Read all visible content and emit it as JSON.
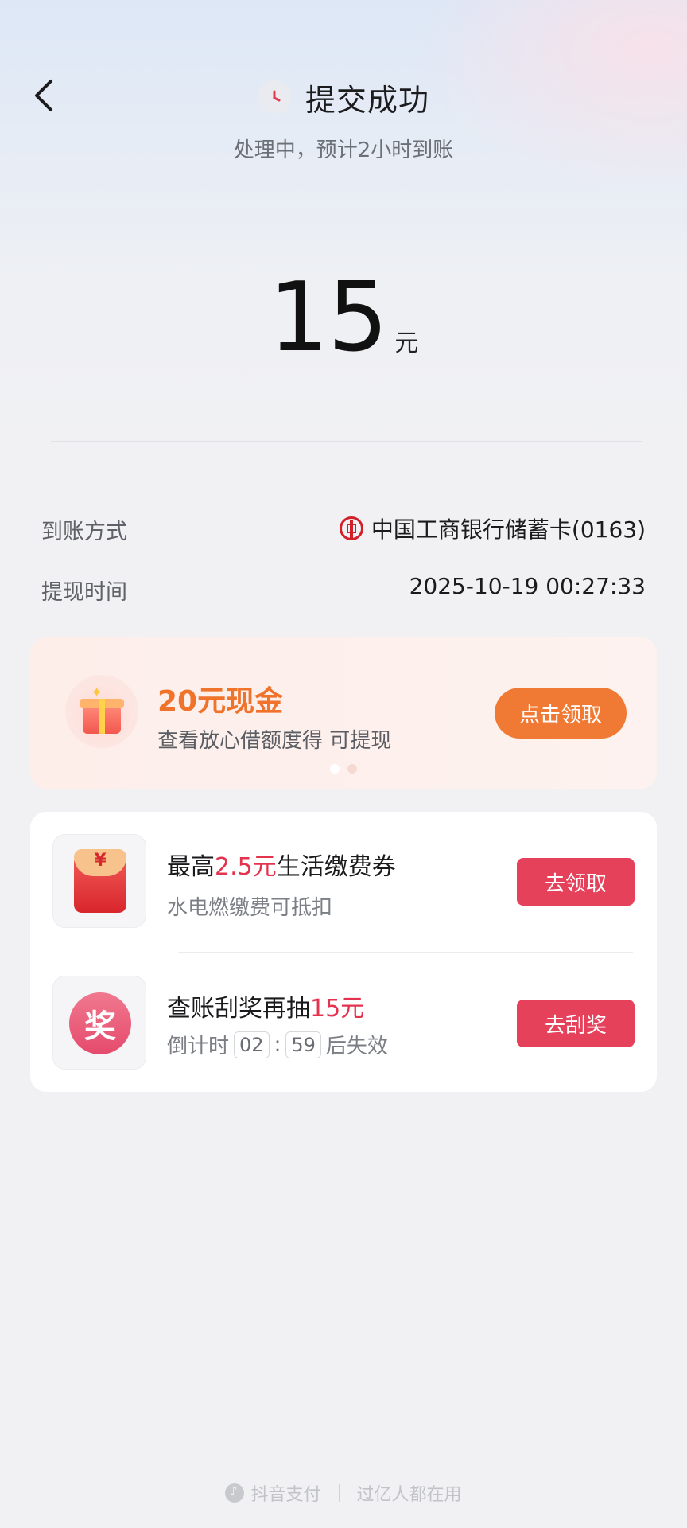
{
  "header": {
    "title": "提交成功",
    "subtitle": "处理中，预计2小时到账"
  },
  "amount": {
    "value": "15",
    "unit": "元"
  },
  "details": {
    "method_label": "到账方式",
    "method_value": "中国工商银行储蓄卡(0163)",
    "time_label": "提现时间",
    "time_value": "2025-10-19 00:27:33"
  },
  "promo_banner": {
    "title": "20元现金",
    "subtitle": "查看放心借额度得 可提现",
    "button": "点击领取",
    "pages": 2,
    "active_page": 1
  },
  "offers": [
    {
      "title_prefix": "最高",
      "title_highlight": "2.5元",
      "title_suffix": "生活缴费券",
      "subtitle": "水电燃缴费可抵扣",
      "button": "去领取"
    },
    {
      "title_prefix": "查账刮奖再抽",
      "title_highlight": "15元",
      "icon_text": "奖",
      "countdown_prefix": "倒计时",
      "countdown_min": "02",
      "countdown_sep": ":",
      "countdown_sec": "59",
      "countdown_suffix": "后失效",
      "button": "去刮奖"
    }
  ],
  "footer": {
    "brand": "抖音支付",
    "slogan": "过亿人都在用"
  },
  "colors": {
    "accent_red": "#e6415b",
    "accent_orange": "#f07a34"
  }
}
